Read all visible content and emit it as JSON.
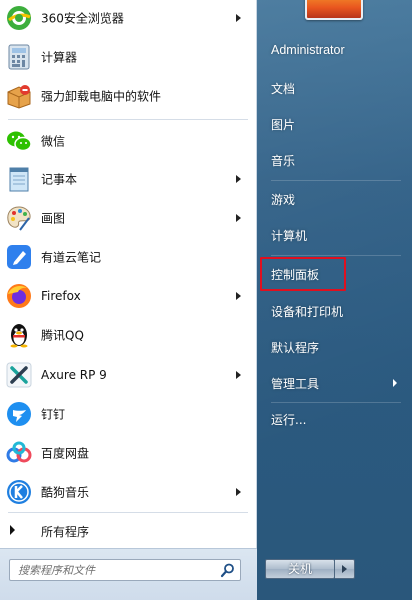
{
  "left_pane": {
    "programs": [
      {
        "id": "360",
        "label": "360安全浏览器",
        "icon": "360-browser-icon",
        "submenu": true
      },
      {
        "id": "calc",
        "label": "计算器",
        "icon": "calculator-icon",
        "submenu": false
      },
      {
        "id": "uninstall",
        "label": "强力卸载电脑中的软件",
        "icon": "uninstaller-icon",
        "submenu": false
      },
      {
        "id": "wechat",
        "label": "微信",
        "icon": "wechat-icon",
        "submenu": false
      },
      {
        "id": "notepad",
        "label": "记事本",
        "icon": "notepad-icon",
        "submenu": true
      },
      {
        "id": "paint",
        "label": "画图",
        "icon": "paint-icon",
        "submenu": true
      },
      {
        "id": "youdao",
        "label": "有道云笔记",
        "icon": "youdao-note-icon",
        "submenu": false
      },
      {
        "id": "firefox",
        "label": "Firefox",
        "icon": "firefox-icon",
        "submenu": true
      },
      {
        "id": "qq",
        "label": "腾讯QQ",
        "icon": "qq-penguin-icon",
        "submenu": false
      },
      {
        "id": "axure",
        "label": "Axure RP 9",
        "icon": "axure-icon",
        "submenu": true
      },
      {
        "id": "dingtalk",
        "label": "钉钉",
        "icon": "dingtalk-icon",
        "submenu": false
      },
      {
        "id": "baidupan",
        "label": "百度网盘",
        "icon": "baidu-netdisk-icon",
        "submenu": false
      },
      {
        "id": "kugou",
        "label": "酷狗音乐",
        "icon": "kugou-music-icon",
        "submenu": true
      }
    ],
    "all_programs_label": "所有程序",
    "search": {
      "placeholder": "搜索程序和文件"
    }
  },
  "right_pane": {
    "items": [
      {
        "label": "Administrator",
        "submenu": false
      },
      {
        "label": "文档",
        "submenu": false
      },
      {
        "label": "图片",
        "submenu": false
      },
      {
        "label": "音乐",
        "submenu": false
      },
      {
        "label": "游戏",
        "submenu": false
      },
      {
        "label": "计算机",
        "submenu": false
      },
      {
        "label": "控制面板",
        "submenu": false,
        "highlighted": true
      },
      {
        "label": "设备和打印机",
        "submenu": false
      },
      {
        "label": "默认程序",
        "submenu": false
      },
      {
        "label": "管理工具",
        "submenu": true
      },
      {
        "label": "运行...",
        "submenu": false
      }
    ],
    "shutdown_label": "关机"
  },
  "colors": {
    "right_pane_bg": "#2f5f86",
    "highlight_border": "#e0101f"
  }
}
